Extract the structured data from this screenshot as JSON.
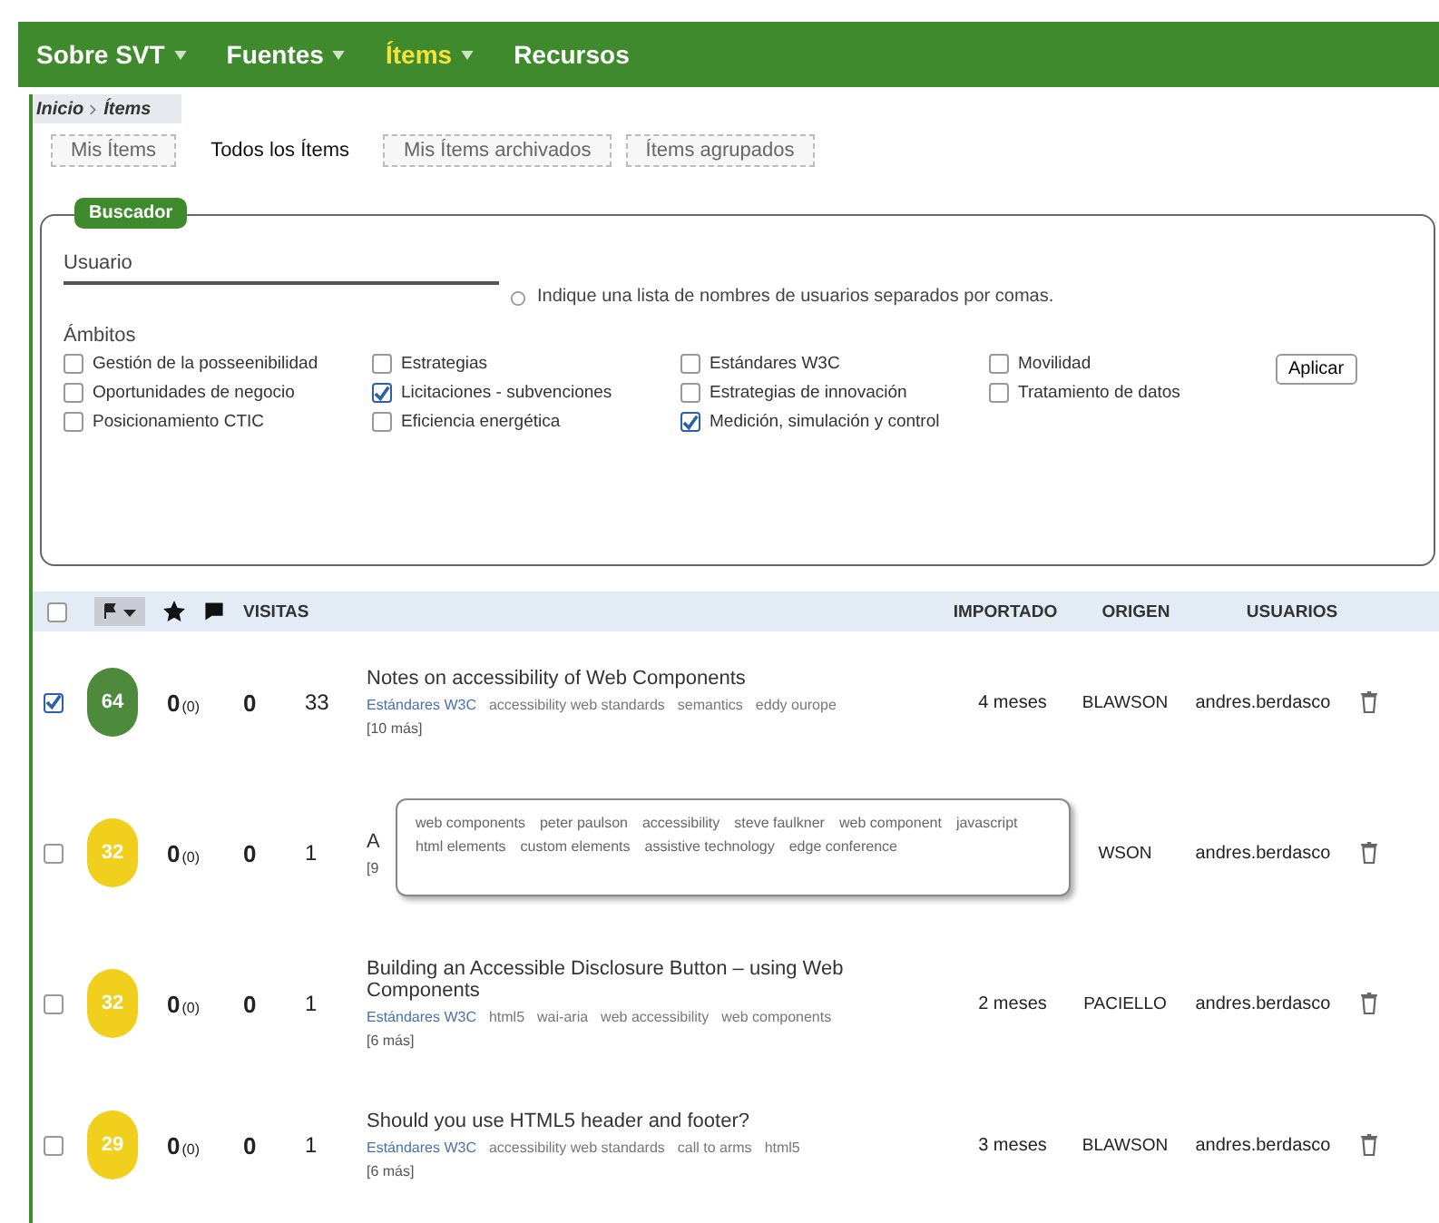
{
  "nav": [
    {
      "label": "Sobre SVT",
      "has_menu": true,
      "selected": false
    },
    {
      "label": "Fuentes",
      "has_menu": true,
      "selected": false
    },
    {
      "label": "Ítems",
      "has_menu": true,
      "selected": true
    },
    {
      "label": "Recursos",
      "has_menu": false,
      "selected": false
    }
  ],
  "breadcrumb": [
    "Inicio",
    "Ítems"
  ],
  "tabs": [
    {
      "label": "Mis Ítems",
      "selected": false
    },
    {
      "label": "Todos los Ítems",
      "selected": true
    },
    {
      "label": "Mis Ítems archivados",
      "selected": false
    },
    {
      "label": "Ítems agrupados",
      "selected": false
    }
  ],
  "search": {
    "legend": "Buscador",
    "user_label": "Usuario",
    "user_hint": "Indique una lista de nombres de usuarios separados por comas.",
    "scopes_label": "Ámbitos",
    "scopes": [
      {
        "label": "Gestión de la posseenibilidad",
        "checked": false
      },
      {
        "label": "Estrategias",
        "checked": false
      },
      {
        "label": "Estándares W3C",
        "checked": false
      },
      {
        "label": "Movilidad",
        "checked": false
      },
      {
        "label": "Oportunidades de negocio",
        "checked": false
      },
      {
        "label": "Licitaciones - subvenciones",
        "checked": true
      },
      {
        "label": "Estrategias de innovación",
        "checked": false
      },
      {
        "label": "Tratamiento de datos",
        "checked": false
      },
      {
        "label": "Posicionamiento CTIC",
        "checked": false
      },
      {
        "label": "Eficiencia energética",
        "checked": false
      },
      {
        "label": "Medición, simulación y control",
        "checked": true
      }
    ],
    "apply": "Aplicar"
  },
  "table": {
    "columns": {
      "visits": "VISITAS",
      "imported": "IMPORTADO",
      "origin": "ORIGEN",
      "users": "USUARIOS"
    },
    "select_all": false,
    "rows": [
      {
        "selected": true,
        "score": "64",
        "color": "#4e8a3c",
        "votes": "0",
        "votes_sub": "(0)",
        "comments": "0",
        "visits": "33",
        "title": "Notes on accessibility of Web Components",
        "tags": [
          {
            "text": "Estándares W3C",
            "kind": "scope"
          },
          {
            "text": "accessibility web standards",
            "kind": "tag"
          },
          {
            "text": "semantics",
            "kind": "tag"
          },
          {
            "text": "eddy ourope",
            "kind": "tag"
          }
        ],
        "more": "[10 más]",
        "imported": "4 meses",
        "origin": "BLAWSON",
        "user": "andres.berdasco"
      },
      {
        "selected": false,
        "score": "32",
        "color": "#f0d01c",
        "votes": "0",
        "votes_sub": "(0)",
        "comments": "0",
        "visits": "1",
        "title": "A",
        "tags": [],
        "more": "[9",
        "imported": "",
        "origin": "WSON",
        "user": "andres.berdasco"
      },
      {
        "selected": false,
        "score": "32",
        "color": "#f0d01c",
        "votes": "0",
        "votes_sub": "(0)",
        "comments": "0",
        "visits": "1",
        "title": "Building an Accessible Disclosure Button – using Web Components",
        "tags": [
          {
            "text": "Estándares W3C",
            "kind": "scope"
          },
          {
            "text": "html5",
            "kind": "tag"
          },
          {
            "text": "wai-aria",
            "kind": "tag"
          },
          {
            "text": "web accessibility",
            "kind": "tag"
          },
          {
            "text": "web components",
            "kind": "tag"
          }
        ],
        "more": "[6 más]",
        "imported": "2 meses",
        "origin": "PACIELLO",
        "user": "andres.berdasco"
      },
      {
        "selected": false,
        "score": "29",
        "color": "#f0d01c",
        "votes": "0",
        "votes_sub": "(0)",
        "comments": "0",
        "visits": "1",
        "title": "Should you use HTML5 header and footer?",
        "tags": [
          {
            "text": "Estándares W3C",
            "kind": "scope"
          },
          {
            "text": "accessibility web standards",
            "kind": "tag"
          },
          {
            "text": "call to arms",
            "kind": "tag"
          },
          {
            "text": "html5",
            "kind": "tag"
          }
        ],
        "more": "[6 más]",
        "imported": "3 meses",
        "origin": "BLAWSON",
        "user": "andres.berdasco"
      }
    ],
    "popup": {
      "tags": [
        "web components",
        "peter paulson",
        "accessibility",
        "steve faulkner",
        "web component",
        "javascript",
        "html elements",
        "custom elements",
        "assistive technology",
        "edge conference"
      ]
    }
  }
}
